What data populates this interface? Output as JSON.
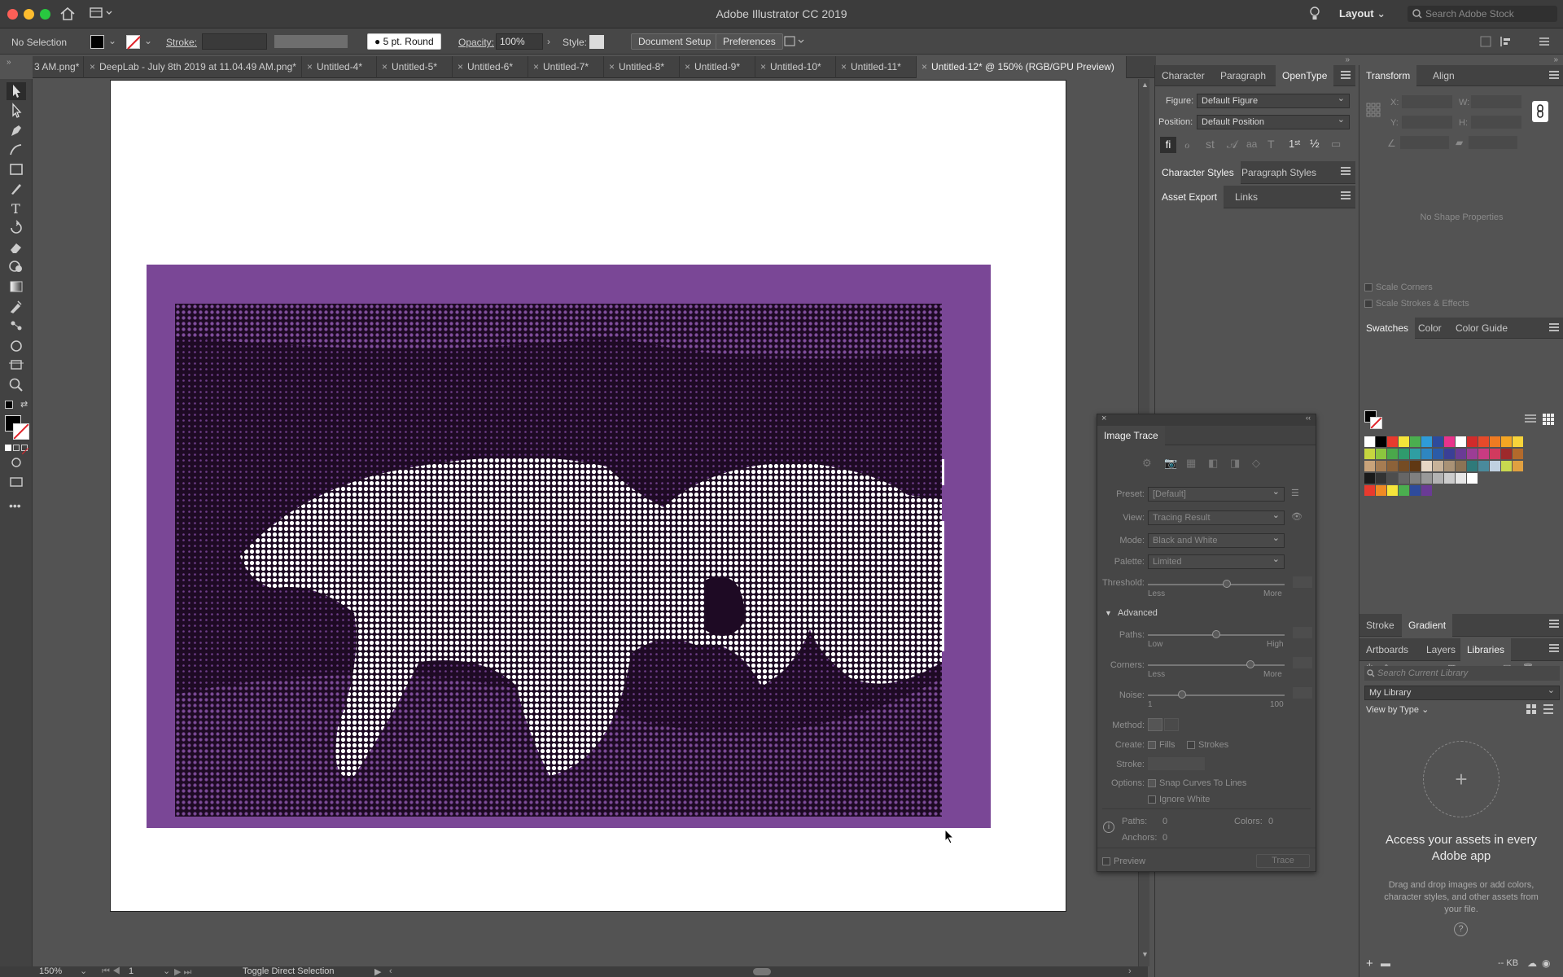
{
  "app": {
    "title": "Adobe Illustrator CC 2019",
    "workspace": "Layout",
    "stock_search_placeholder": "Search Adobe Stock"
  },
  "control_bar": {
    "selection": "No Selection",
    "stroke_label": "Stroke:",
    "brush": "5 pt. Round",
    "opacity_label": "Opacity:",
    "opacity_value": "100%",
    "style_label": "Style:",
    "document_setup": "Document Setup",
    "preferences": "Preferences"
  },
  "tabs": [
    {
      "label": "3 AM.png*"
    },
    {
      "label": "DeepLab - July 8th 2019 at 11.04.49 AM.png*"
    },
    {
      "label": "Untitled-4*"
    },
    {
      "label": "Untitled-5*"
    },
    {
      "label": "Untitled-6*"
    },
    {
      "label": "Untitled-7*"
    },
    {
      "label": "Untitled-8*"
    },
    {
      "label": "Untitled-9*"
    },
    {
      "label": "Untitled-10*"
    },
    {
      "label": "Untitled-11*"
    },
    {
      "label": "Untitled-12* @ 150% (RGB/GPU Preview)"
    }
  ],
  "status_bar": {
    "zoom": "150%",
    "artboard": "1",
    "tool_hint": "Toggle Direct Selection"
  },
  "character_panel": {
    "tabs": [
      "Character",
      "Paragraph",
      "OpenType"
    ],
    "figure_label": "Figure:",
    "figure_value": "Default Figure",
    "position_label": "Position:",
    "position_value": "Default Position"
  },
  "styles_panel": {
    "tabs": [
      "Character Styles",
      "Paragraph Styles"
    ]
  },
  "asset_panel": {
    "tabs": [
      "Asset Export",
      "Links"
    ]
  },
  "transform_panel": {
    "tabs": [
      "Transform",
      "Align"
    ],
    "x_label": "X:",
    "y_label": "Y:",
    "w_label": "W:",
    "h_label": "H:",
    "empty_text": "No Shape Properties",
    "scale_corners": "Scale Corners",
    "scale_strokes": "Scale Strokes & Effects"
  },
  "swatches_panel": {
    "tabs": [
      "Swatches",
      "Color",
      "Color Guide"
    ],
    "row1": [
      "#ffffff",
      "#000000",
      "#e83a2e",
      "#f6e53a",
      "#4bae4f",
      "#2e9bd8",
      "#2e4b9c",
      "#e8338b",
      "#ffffff",
      "#d12b2b",
      "#e64a2a",
      "#ef7b22",
      "#f5a623",
      "#f8d43a"
    ],
    "row2": [
      "#c6d63f",
      "#8cc63e",
      "#4aa84b",
      "#2f9b6d",
      "#2f9ea2",
      "#2e86c1",
      "#2b5ba8",
      "#3a3f96",
      "#6a3b95",
      "#9c3d95",
      "#c83b82",
      "#d13a5e",
      "#9e2a2b",
      "#b36a2b"
    ],
    "row3": [
      "#c9a37a",
      "#a67c52",
      "#8c6239",
      "#754c24",
      "#603813",
      "#e7d7c5",
      "#c7b299",
      "#a99276",
      "#8b7355",
      "#2f7a7a",
      "#4a8a9c",
      "#c0d0e0",
      "#c9d94f",
      "#e0a040"
    ],
    "row4": [
      "#1a1a1a",
      "#333333",
      "#4d4d4d",
      "#666666",
      "#808080",
      "#999999",
      "#b3b3b3",
      "#cccccc",
      "#e6e6e6",
      "#ffffff"
    ],
    "row5": [
      "#e83a2e",
      "#f08a24",
      "#f6e53a",
      "#4bae4f",
      "#2e4b9c",
      "#6a3b95"
    ]
  },
  "stroke_gradient_panel": {
    "tabs": [
      "Stroke",
      "Gradient"
    ]
  },
  "libraries_panel": {
    "tabs": [
      "Artboards",
      "Layers",
      "Libraries"
    ],
    "search_placeholder": "Search Current Library",
    "library": "My Library",
    "view_by": "View by Type",
    "headline": "Access your assets in every Adobe app",
    "description": "Drag and drop images or add colors, character styles, and other assets from your file.",
    "storage": "-- KB"
  },
  "image_trace": {
    "title": "Image Trace",
    "preset_label": "Preset:",
    "preset_value": "[Default]",
    "view_label": "View:",
    "view_value": "Tracing Result",
    "mode_label": "Mode:",
    "mode_value": "Black and White",
    "palette_label": "Palette:",
    "palette_value": "Limited",
    "threshold_label": "Threshold:",
    "threshold_less": "Less",
    "threshold_more": "More",
    "threshold_value": 0.58,
    "advanced": "Advanced",
    "paths_label": "Paths:",
    "paths_low": "Low",
    "paths_high": "High",
    "paths_value": 0.5,
    "corners_label": "Corners:",
    "corners_less": "Less",
    "corners_more": "More",
    "corners_value": 0.75,
    "noise_label": "Noise:",
    "noise_min": "1",
    "noise_max": "100",
    "noise_value": 0.25,
    "method_label": "Method:",
    "create_label": "Create:",
    "fills": "Fills",
    "strokes": "Strokes",
    "stroke_label": "Stroke:",
    "options_label": "Options:",
    "snap": "Snap Curves To Lines",
    "ignore_white": "Ignore White",
    "paths_stat_label": "Paths:",
    "paths_stat": "0",
    "colors_stat_label": "Colors:",
    "colors_stat": "0",
    "anchors_stat_label": "Anchors:",
    "anchors_stat": "0",
    "preview": "Preview",
    "trace": "Trace"
  }
}
